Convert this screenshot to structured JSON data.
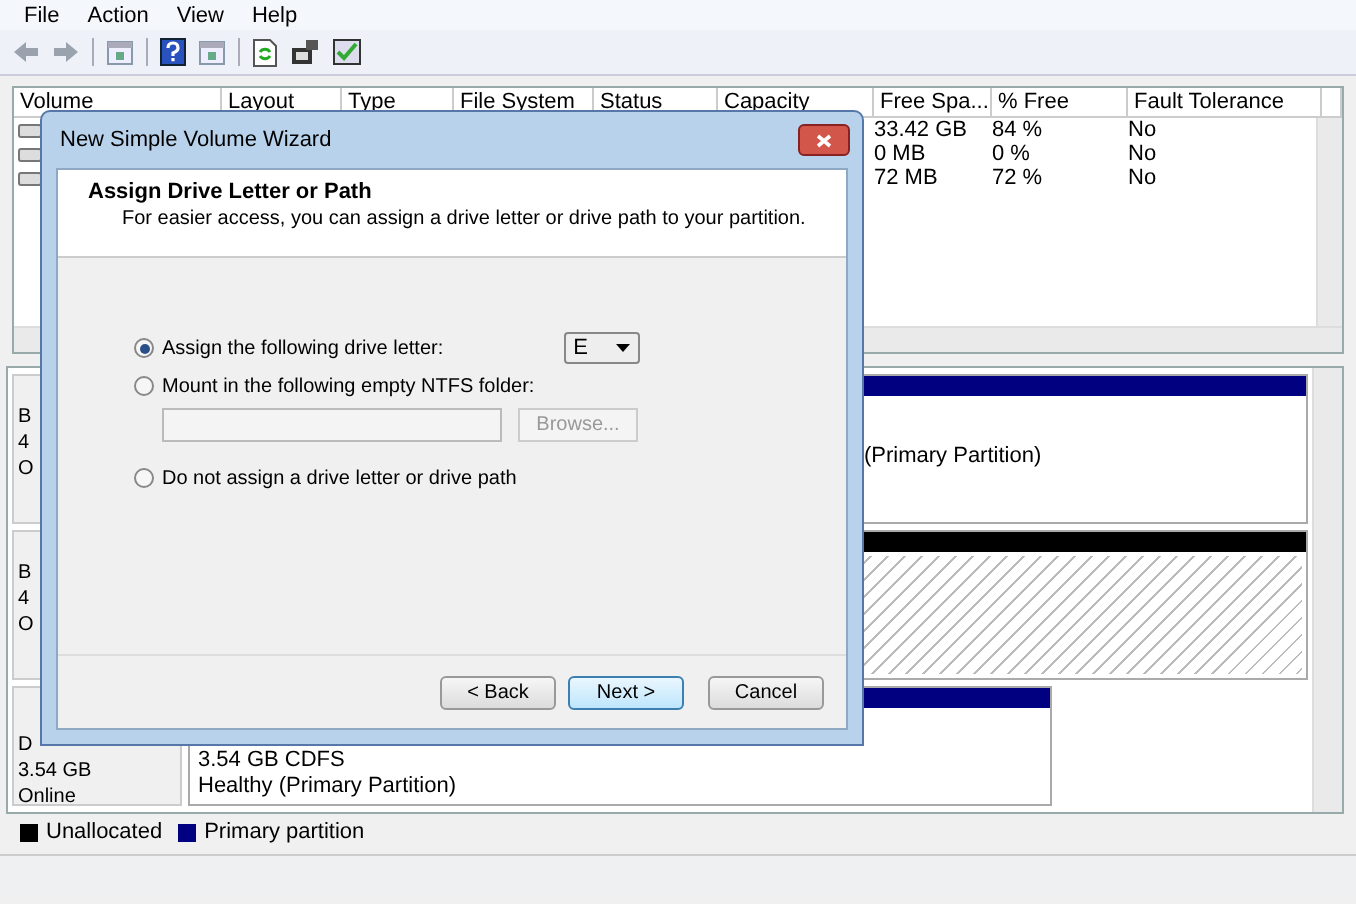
{
  "menu": [
    "File",
    "Action",
    "View",
    "Help"
  ],
  "table": {
    "columns": [
      "Volume",
      "Layout",
      "Type",
      "File System",
      "Status",
      "Capacity",
      "Free Spa...",
      "% Free",
      "Fault Tolerance"
    ],
    "rows": [
      {
        "free": "33.42 GB",
        "pct": "84 %",
        "fault": "No"
      },
      {
        "free": "0 MB",
        "pct": "0 %",
        "fault": "No"
      },
      {
        "free": "72 MB",
        "pct": "72 %",
        "fault": "No"
      }
    ]
  },
  "disks": [
    {
      "label": [
        "B",
        "4",
        "O"
      ],
      "kind": "partition",
      "lines": [
        "(Primary Partition)"
      ]
    },
    {
      "label": [
        "B",
        "4",
        "O"
      ],
      "kind": "unallocated"
    },
    {
      "label": [
        "D",
        "3.54 GB",
        "Online"
      ],
      "kind": "partition",
      "lines": [
        "3.54 GB CDFS",
        "Healthy (Primary Partition)"
      ]
    }
  ],
  "legend": [
    {
      "label": "Unallocated",
      "color": "#000000"
    },
    {
      "label": "Primary partition",
      "color": "#000080"
    }
  ],
  "dialog": {
    "title": "New Simple Volume Wizard",
    "heading": "Assign Drive Letter or Path",
    "subtitle": "For easier access, you can assign a drive letter or drive path to your partition.",
    "options": [
      {
        "label": "Assign the following drive letter:",
        "selected": true,
        "kind": "letter",
        "value": "E"
      },
      {
        "label": "Mount in the following empty NTFS folder:",
        "selected": false,
        "kind": "folder",
        "browse": "Browse...",
        "browse_disabled": true
      },
      {
        "label": "Do not assign a drive letter or drive path",
        "selected": false,
        "kind": "none"
      }
    ],
    "buttons": [
      {
        "label": "< Back",
        "default": false
      },
      {
        "label": "Next >",
        "default": true
      },
      {
        "label": "Cancel",
        "default": false
      }
    ]
  }
}
